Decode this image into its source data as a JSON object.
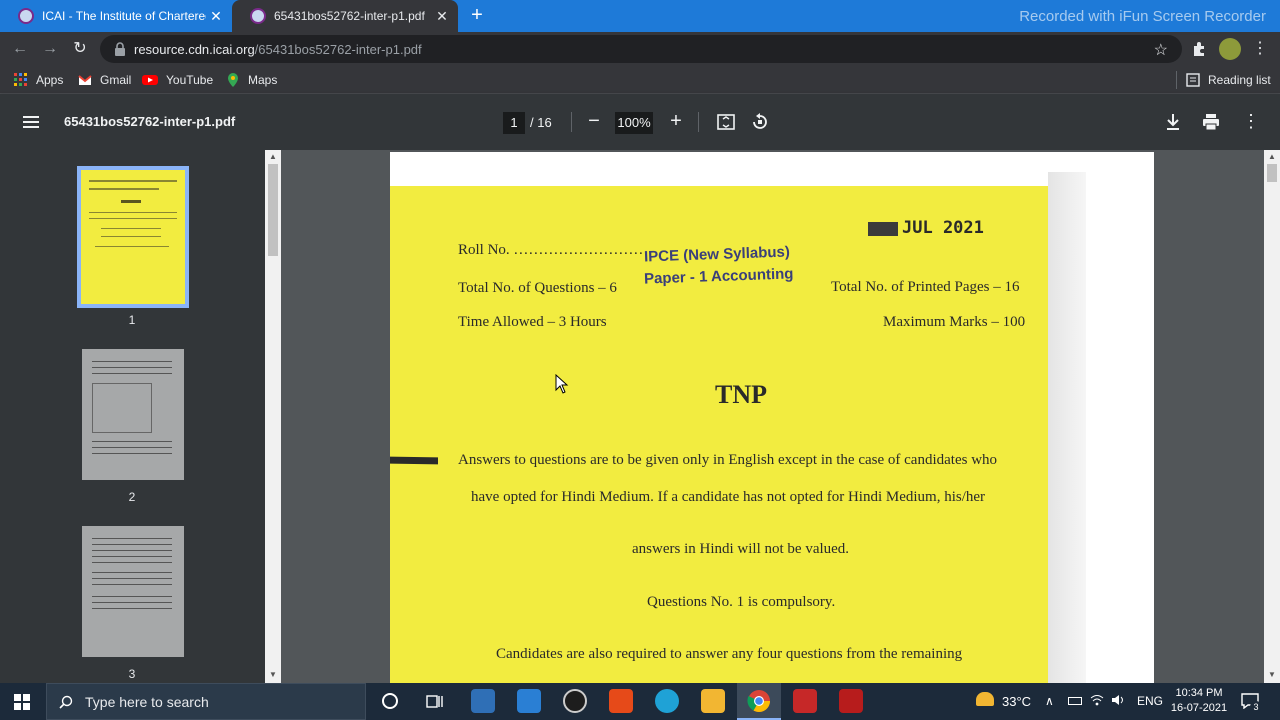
{
  "tabs": [
    {
      "title": "ICAI - The Institute of Chartered",
      "active": false
    },
    {
      "title": "65431bos52762-inter-p1.pdf",
      "active": true
    }
  ],
  "watermark": "Recorded with iFun Screen Recorder",
  "address": {
    "host": "resource.cdn.icai.org",
    "path": "/65431bos52762-inter-p1.pdf"
  },
  "bookmarks": [
    "Apps",
    "Gmail",
    "YouTube",
    "Maps"
  ],
  "reading_list": "Reading list",
  "pdf": {
    "filename": "65431bos52762-inter-p1.pdf",
    "current_page": "1",
    "total_pages": "/ 16",
    "zoom": "100%"
  },
  "thumbnails": [
    "1",
    "2",
    "3"
  ],
  "document": {
    "date_stamp": "JUL 2021",
    "roll_no": "Roll No. ………………………",
    "course_stamp_1": "IPCE (New Syllabus)",
    "course_stamp_2": "Paper - 1 Accounting",
    "total_questions": "Total No. of Questions – 6",
    "printed_pages": "Total No. of Printed Pages – 16",
    "time_allowed": "Time Allowed – 3 Hours",
    "max_marks": "Maximum Marks – 100",
    "code": "TNP",
    "instr_1": "Answers to questions are to be given only in English except in the case of candidates who",
    "instr_2": "have opted for Hindi Medium. If a candidate has not opted for Hindi Medium, his/her",
    "instr_3": "answers in Hindi will not be valued.",
    "instr_4": "Questions No. 1 is compulsory.",
    "instr_5": "Candidates are also required to answer any four questions from the remaining"
  },
  "taskbar": {
    "search_placeholder": "Type here to search",
    "temperature": "33°C",
    "language": "ENG",
    "time": "10:34 PM",
    "date": "16-07-2021",
    "notifications": "3"
  },
  "colors": {
    "tabstrip": "#1e7ad8",
    "chrome_dark": "#35363a",
    "pdf_toolbar": "#323639",
    "page_yellow": "#f2ec40",
    "thumb_selected": "#8ab4f8"
  }
}
